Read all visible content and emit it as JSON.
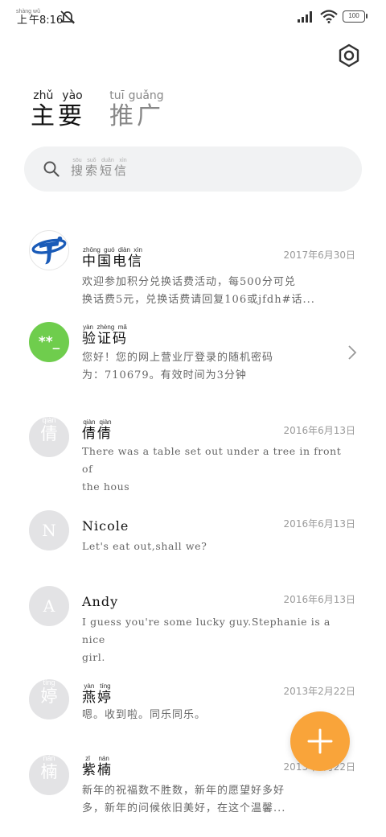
{
  "status_bar": {
    "time_prefix": "上午",
    "time_prefix_pinyin": "shàng wǔ",
    "time": "8:16",
    "battery": "100"
  },
  "tabs": [
    {
      "label": "主要",
      "pinyin": "zhǔ yào",
      "active": true
    },
    {
      "label": "推广",
      "pinyin": "tuī guǎng",
      "active": false
    }
  ],
  "search": {
    "placeholder": "搜索短信",
    "pinyin": "sōu suǒ duǎn xìn"
  },
  "conversations": [
    {
      "name": "中国电信",
      "name_pinyin": "zhōng guó diàn xìn",
      "date": "2017年6月30日",
      "preview_line1": "欢迎参加积分兑换话费活动，每500分可兑",
      "preview_line2": "换话费5元，兑换话费请回复106或jfdh#话...",
      "avatar": "china-telecom-logo"
    },
    {
      "name": "验证码",
      "name_pinyin": "yàn zhèng mǎ",
      "date": "",
      "preview_line1": "您好！您的网上营业厅登录的随机密码",
      "preview_line2": "为：710679。有效时间为3分钟",
      "avatar_text": "**_",
      "avatar_color": "#6fcd4d"
    },
    {
      "name": "倩倩",
      "name_pinyin": "qiàn qiàn",
      "date": "2016年6月13日",
      "preview_line1": "There was a table set out under a tree in front of",
      "preview_line2": "the hous",
      "avatar_text": "倩",
      "avatar_pinyin": "qiàn"
    },
    {
      "name": "Nicole",
      "date": "2016年6月13日",
      "preview_line1": "Let's eat out,shall we?",
      "preview_line2": "",
      "avatar_text": "N"
    },
    {
      "name": "Andy",
      "date": "2016年6月13日",
      "preview_line1": "I guess you're some lucky guy.Stephanie is a nice",
      "preview_line2": "girl.",
      "avatar_text": "A"
    },
    {
      "name": "燕婷",
      "name_pinyin": "yàn tíng",
      "date": "2013年2月22日",
      "preview_line1": "嗯。收到啦。同乐同乐。",
      "preview_line2": "",
      "avatar_text": "婷",
      "avatar_pinyin": "tíng"
    },
    {
      "name": "紫楠",
      "name_pinyin": "zǐ nán",
      "date": "2013年2月22日",
      "preview_line1": "新年的祝福数不胜数，新年的愿望好多好",
      "preview_line2": "多，新年的问候依旧美好，在这个温馨...",
      "avatar_text": "楠",
      "avatar_pinyin": "nán"
    }
  ],
  "fab": {
    "icon": "plus-icon",
    "color": "#f9a43a"
  },
  "colors": {
    "avatar_gray": "#e3e3e5",
    "search_bg": "#f1f2f3",
    "telecom_blue": "#1a5bb8",
    "code_green": "#6fcd4d"
  }
}
